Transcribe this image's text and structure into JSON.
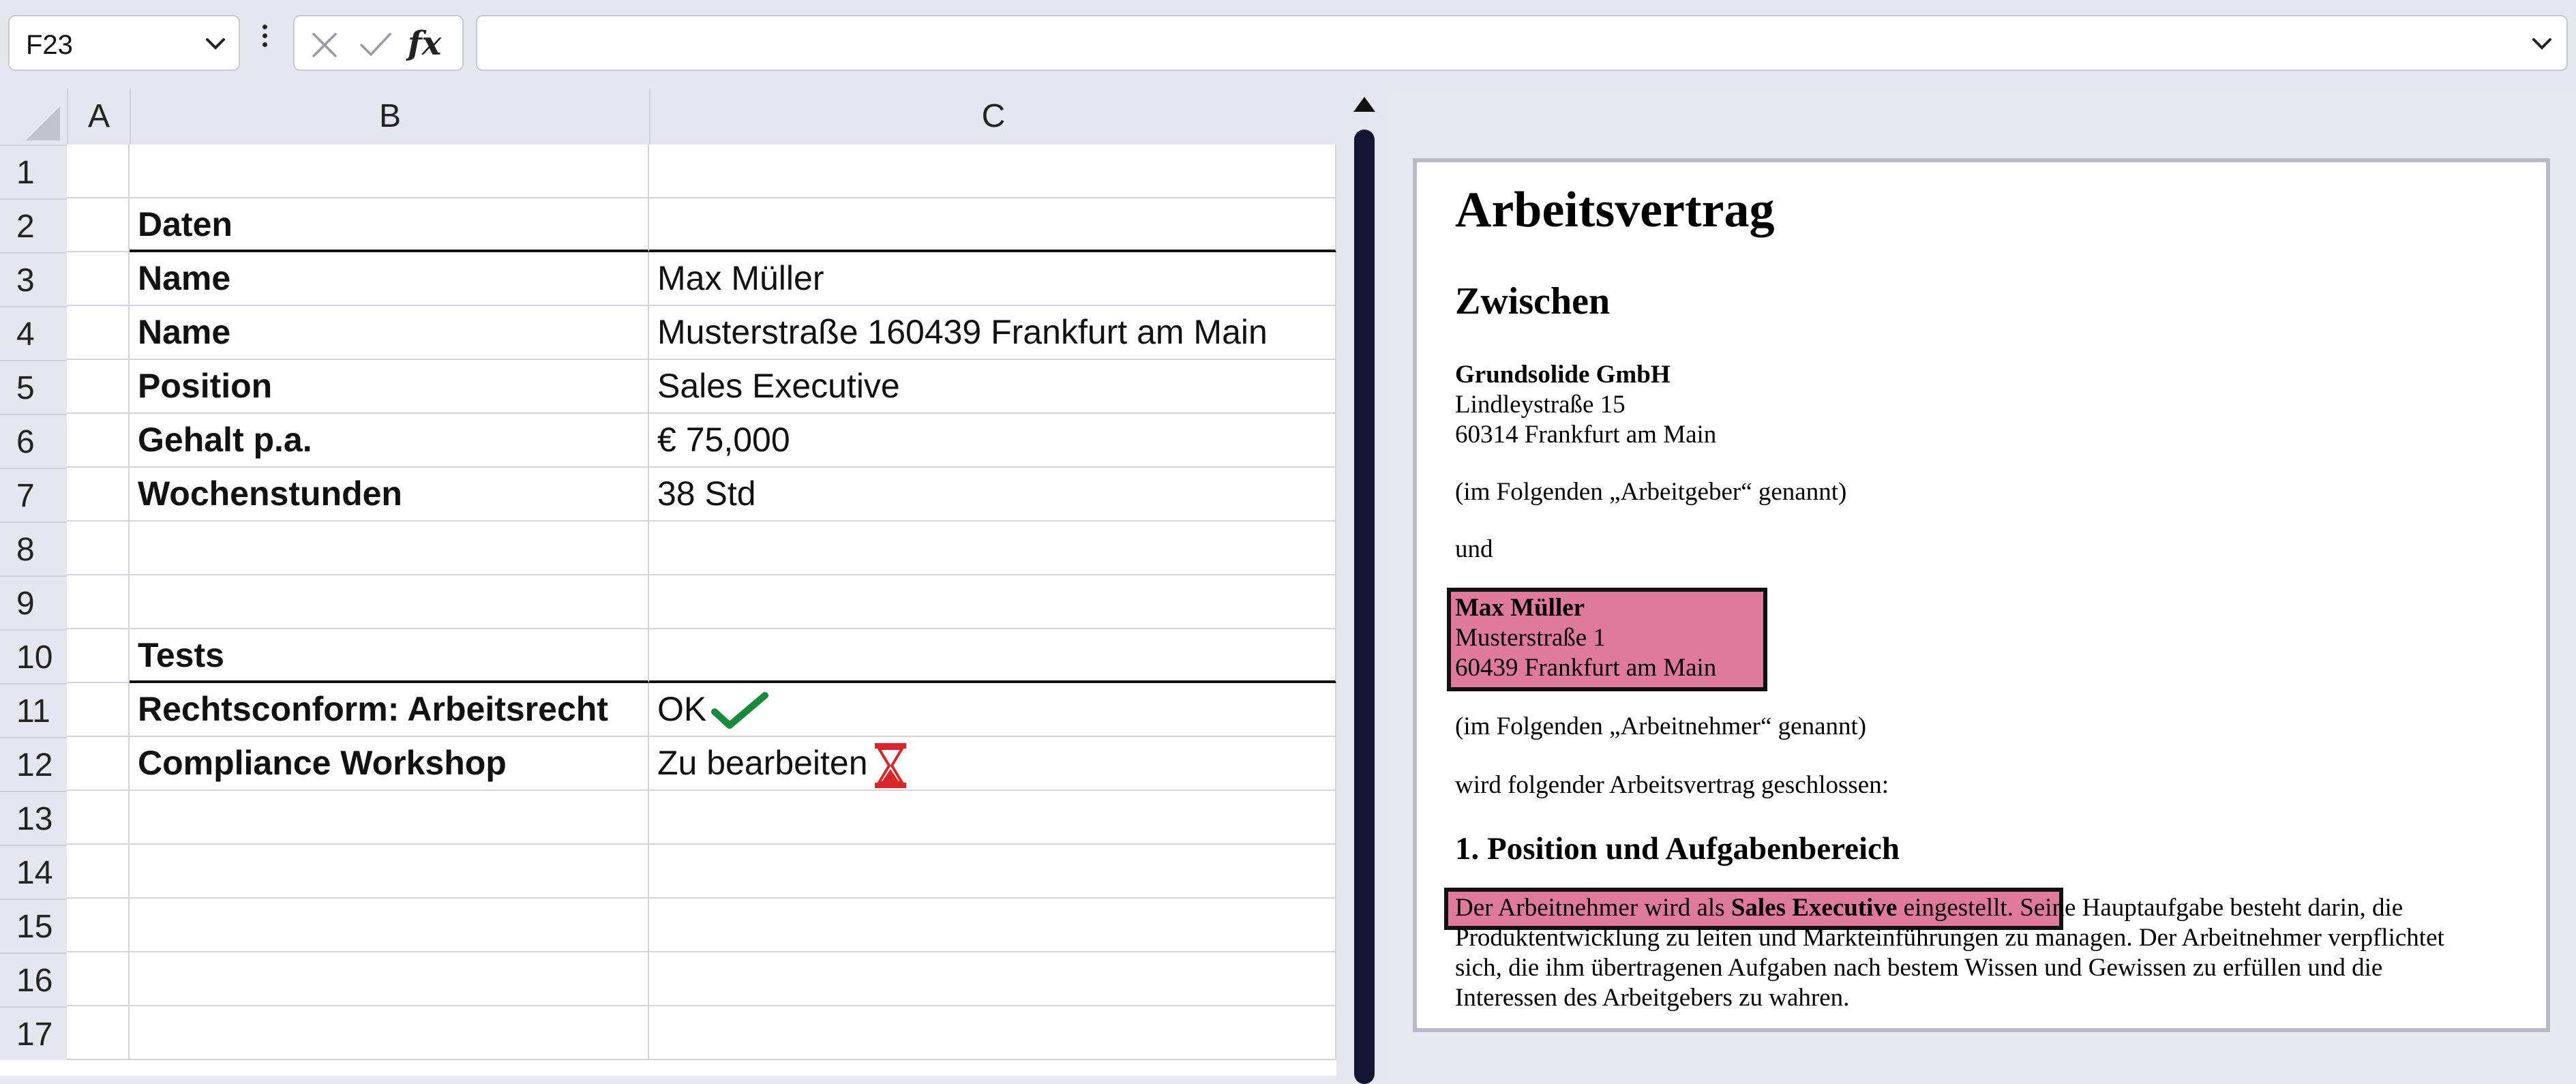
{
  "formula_bar": {
    "name_box": "F23",
    "fx": "fx",
    "formula": ""
  },
  "sheet": {
    "columns": [
      "A",
      "B",
      "C"
    ],
    "rows": [
      {
        "n": "1",
        "b": "",
        "c": ""
      },
      {
        "n": "2",
        "b": "Daten",
        "c": ""
      },
      {
        "n": "3",
        "b": "Name",
        "c": "Max Müller"
      },
      {
        "n": "4",
        "b": "Name",
        "c": "Musterstraße 160439 Frankfurt am Main"
      },
      {
        "n": "5",
        "b": "Position",
        "c": "Sales Executive"
      },
      {
        "n": "6",
        "b": "Gehalt p.a.",
        "c": "€ 75,000"
      },
      {
        "n": "7",
        "b": "Wochenstunden",
        "c": "38 Std"
      },
      {
        "n": "8",
        "b": "",
        "c": ""
      },
      {
        "n": "9",
        "b": "",
        "c": ""
      },
      {
        "n": "10",
        "b": "Tests",
        "c": ""
      },
      {
        "n": "11",
        "b": "Rechtsconform: Arbeitsrecht",
        "c": "OK"
      },
      {
        "n": "12",
        "b": "Compliance Workshop",
        "c": "Zu bearbeiten"
      },
      {
        "n": "13",
        "b": "",
        "c": ""
      },
      {
        "n": "14",
        "b": "",
        "c": ""
      },
      {
        "n": "15",
        "b": "",
        "c": ""
      },
      {
        "n": "16",
        "b": "",
        "c": ""
      },
      {
        "n": "17",
        "b": "",
        "c": ""
      }
    ],
    "status_icons": {
      "ok": "checkmark-icon",
      "pending": "hourglass-icon"
    },
    "colors": {
      "ok": "#1a8a3a",
      "pending": "#d9262c",
      "highlight": "#e07a9c"
    }
  },
  "document": {
    "title": "Arbeitsvertrag",
    "between": "Zwischen",
    "employer_name": "Grundsolide GmbH",
    "employer_street": "Lindleystraße 15",
    "employer_city": "60314 Frankfurt am Main",
    "employer_note": "(im Folgenden „Arbeitgeber“ genannt)",
    "and": "und",
    "employee_name": "Max Müller",
    "employee_street": "Musterstraße 1",
    "employee_city": "60439 Frankfurt am Main",
    "employee_note": "(im Folgenden „Arbeitnehmer“ genannt)",
    "concluded": "wird folgender Arbeitsvertrag geschlossen:",
    "section1_title": "1. Position und Aufgabenbereich",
    "section1_hl_pre": "Der Arbeitnehmer wird als ",
    "section1_hl_bold": "Sales Executive",
    "section1_hl_post": " eingestellt.",
    "section1_rest_1": " Seine Hauptaufgabe besteht darin, die",
    "section1_line2": "Produktentwicklung zu leiten und Markteinführungen zu managen. Der Arbeitnehmer verpflichtet",
    "section1_line3": "sich, die ihm übertragenen Aufgaben nach bestem Wissen und Gewissen zu erfüllen und die",
    "section1_line4": "Interessen des Arbeitgebers zu wahren."
  }
}
